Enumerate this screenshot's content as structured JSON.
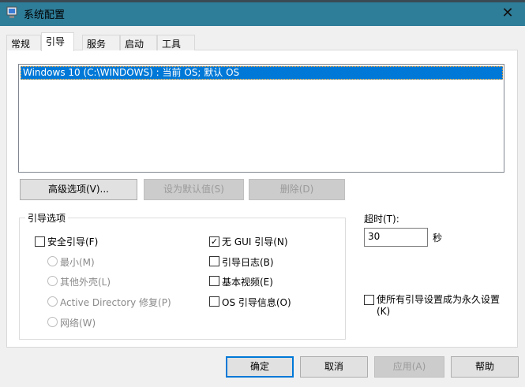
{
  "window": {
    "title": "系统配置",
    "close": "✕"
  },
  "tabs": [
    "常规",
    "引导",
    "服务",
    "启动",
    "工具"
  ],
  "boot_list": [
    "Windows 10 (C:\\WINDOWS) : 当前 OS; 默认 OS"
  ],
  "buttons": {
    "advanced": "高级选项(V)...",
    "set_default": "设为默认值(S)",
    "delete": "删除(D)"
  },
  "boot_options": {
    "label": "引导选项",
    "safe_boot": {
      "label": "安全引导(F)",
      "checked": false
    },
    "radios": [
      "最小(M)",
      "其他外壳(L)",
      "Active Directory 修复(P)",
      "网络(W)"
    ],
    "no_gui": {
      "label": "无 GUI 引导(N)",
      "checked": true
    },
    "boot_log": {
      "label": "引导日志(B)",
      "checked": false
    },
    "base_video": {
      "label": "基本视频(E)",
      "checked": false
    },
    "os_info": {
      "label": "OS 引导信息(O)",
      "checked": false
    }
  },
  "timeout": {
    "label": "超时(T):",
    "value": "30",
    "unit": "秒"
  },
  "permanent": {
    "label_line1": "使所有引导设置成为永久设置",
    "label_line2": "(K)",
    "checked": false
  },
  "footer": {
    "ok": "确定",
    "cancel": "取消",
    "apply": "应用(A)",
    "help": "帮助"
  }
}
